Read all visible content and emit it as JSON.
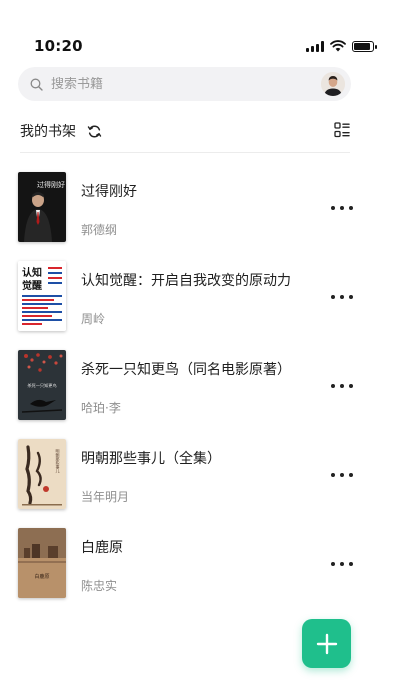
{
  "status_bar": {
    "time": "10:20",
    "icons": [
      "signal-icon",
      "wifi-icon",
      "battery-icon"
    ],
    "battery_level": 0.9
  },
  "search": {
    "placeholder": "搜索书籍",
    "icon": "search-icon"
  },
  "shelf": {
    "title": "我的书架",
    "refresh_icon": "refresh-icon",
    "layout_icon": "grid-list-toggle-icon"
  },
  "books": [
    {
      "title": "过得刚好",
      "author": "郭德纲",
      "cover_text": "过得刚好"
    },
    {
      "title": "认知觉醒：开启自我改变的原动力",
      "author": "周岭",
      "cover_text": "认知觉醒"
    },
    {
      "title": "杀死一只知更鸟（同名电影原著）",
      "author": "哈珀·李",
      "cover_text": "杀死一只知更鸟"
    },
    {
      "title": "明朝那些事儿（全集）",
      "author": "当年明月",
      "cover_text": "明朝那些事儿"
    },
    {
      "title": "白鹿原",
      "author": "陈忠实",
      "cover_text": "白鹿原"
    }
  ],
  "fab": {
    "icon": "plus-icon"
  },
  "colors": {
    "accent": "#1fbf8c",
    "search_bg": "#f2f2f4",
    "secondary_text": "#8f8f8f"
  }
}
